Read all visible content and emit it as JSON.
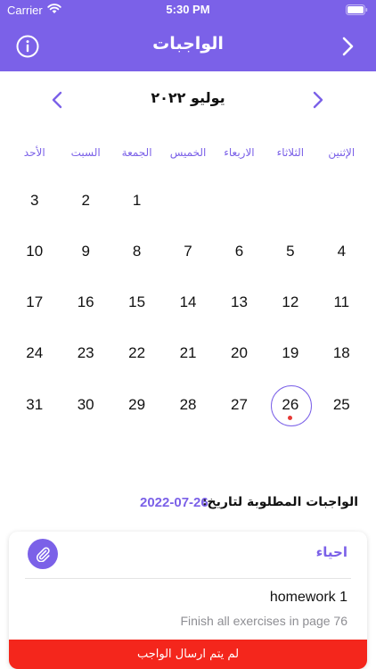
{
  "status_bar": {
    "carrier": "Carrier",
    "time": "5:30 PM"
  },
  "nav": {
    "title": "الواجبات",
    "left_icon": "info-icon",
    "right_icon": "chevron-right-icon"
  },
  "calendar": {
    "month_title": "يوليو ٢٠٢٢",
    "weekdays": [
      "الإثنين",
      "الثلاثاء",
      "الاربعاء",
      "الخميس",
      "الجمعة",
      "السبت",
      "الأحد"
    ],
    "weeks": [
      [
        "",
        "",
        "",
        "",
        "1",
        "2",
        "3"
      ],
      [
        "4",
        "5",
        "6",
        "7",
        "8",
        "9",
        "10"
      ],
      [
        "11",
        "12",
        "13",
        "14",
        "15",
        "16",
        "17"
      ],
      [
        "18",
        "19",
        "20",
        "21",
        "22",
        "23",
        "24"
      ],
      [
        "25",
        "26",
        "27",
        "28",
        "29",
        "30",
        "31"
      ]
    ],
    "selected_day": "26",
    "event_days": [
      "26"
    ]
  },
  "due": {
    "label": "الواجبات المطلوبة لتاريخ:",
    "date": "2022-07-26"
  },
  "homework": {
    "subject": "احياء",
    "title": "homework 1",
    "description": "Finish all exercises in page 76",
    "status": "لم يتم ارسال الواجب",
    "attach_icon": "paperclip-icon"
  },
  "colors": {
    "accent": "#7b61e8",
    "status_bar_bg": "#7b61e8",
    "status_red": "#f4261c",
    "event_dot": "#e53935"
  }
}
